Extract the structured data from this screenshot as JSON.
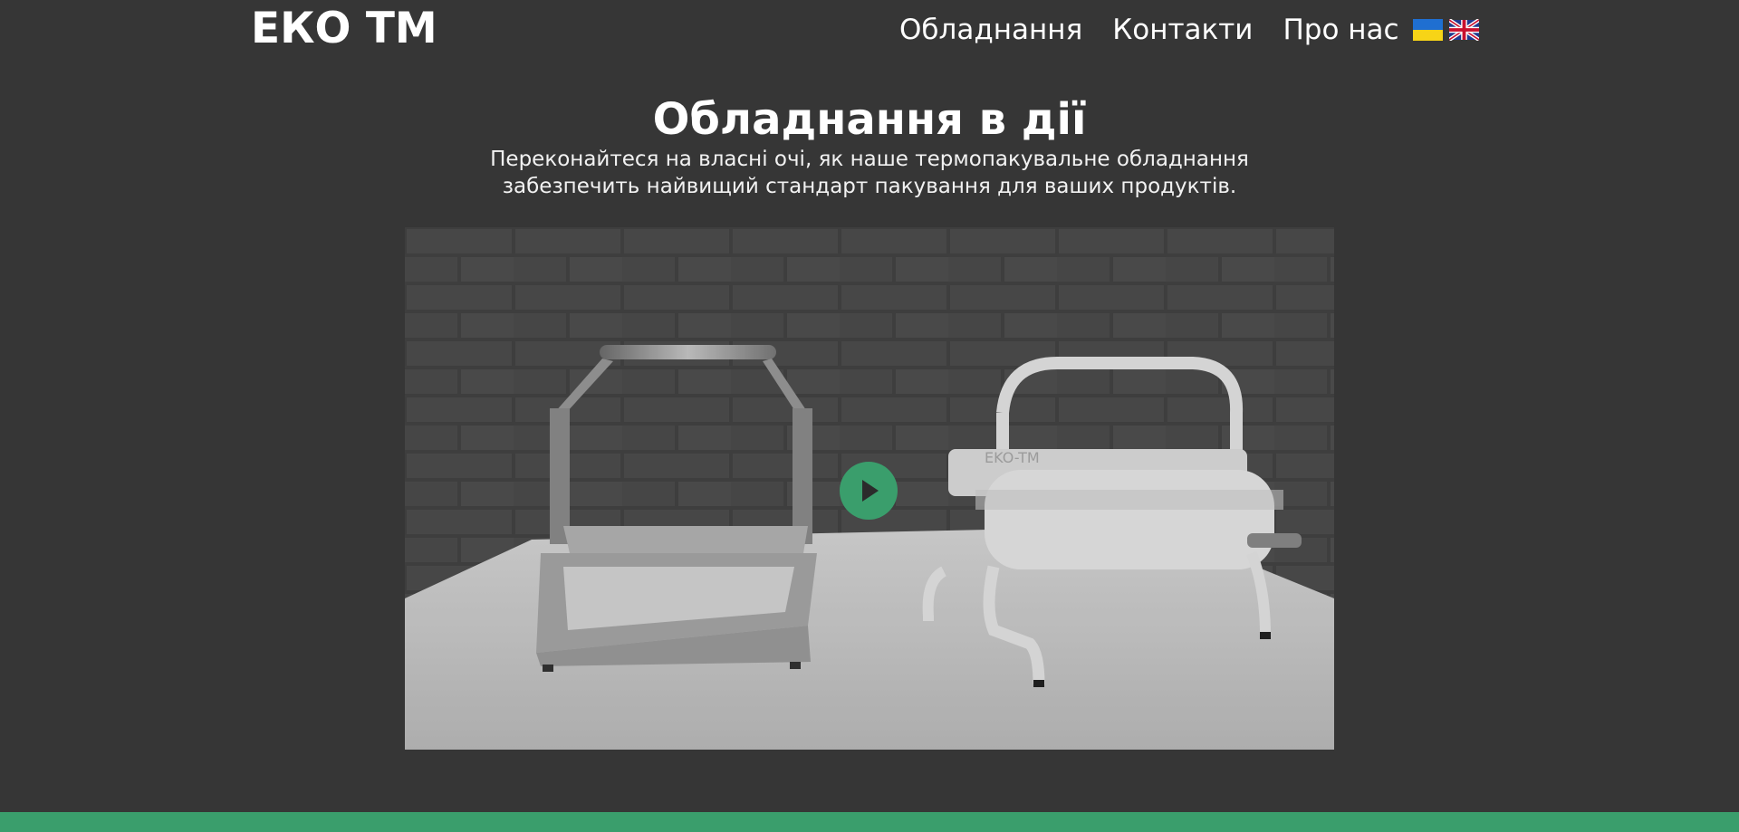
{
  "header": {
    "logo": "ЕКО ТМ",
    "nav": [
      {
        "label": "Обладнання"
      },
      {
        "label": "Контакти"
      },
      {
        "label": "Про нас"
      }
    ],
    "languages": [
      {
        "code": "uk",
        "icon": "ukraine-flag-icon"
      },
      {
        "code": "en",
        "icon": "uk-flag-icon"
      }
    ]
  },
  "hero": {
    "title": "Обладнання в дії",
    "subtitle_lines": [
      "Переконайтеся на власні очі, як наше термопакувальне обладнання",
      "забезпечить найвищий стандарт пакування для ваших продуктів."
    ]
  },
  "video": {
    "machine_label": "EKO-TM",
    "play_icon": "play-icon"
  },
  "colors": {
    "background": "#363636",
    "accent": "#3a9e6c",
    "text": "#ffffff"
  }
}
